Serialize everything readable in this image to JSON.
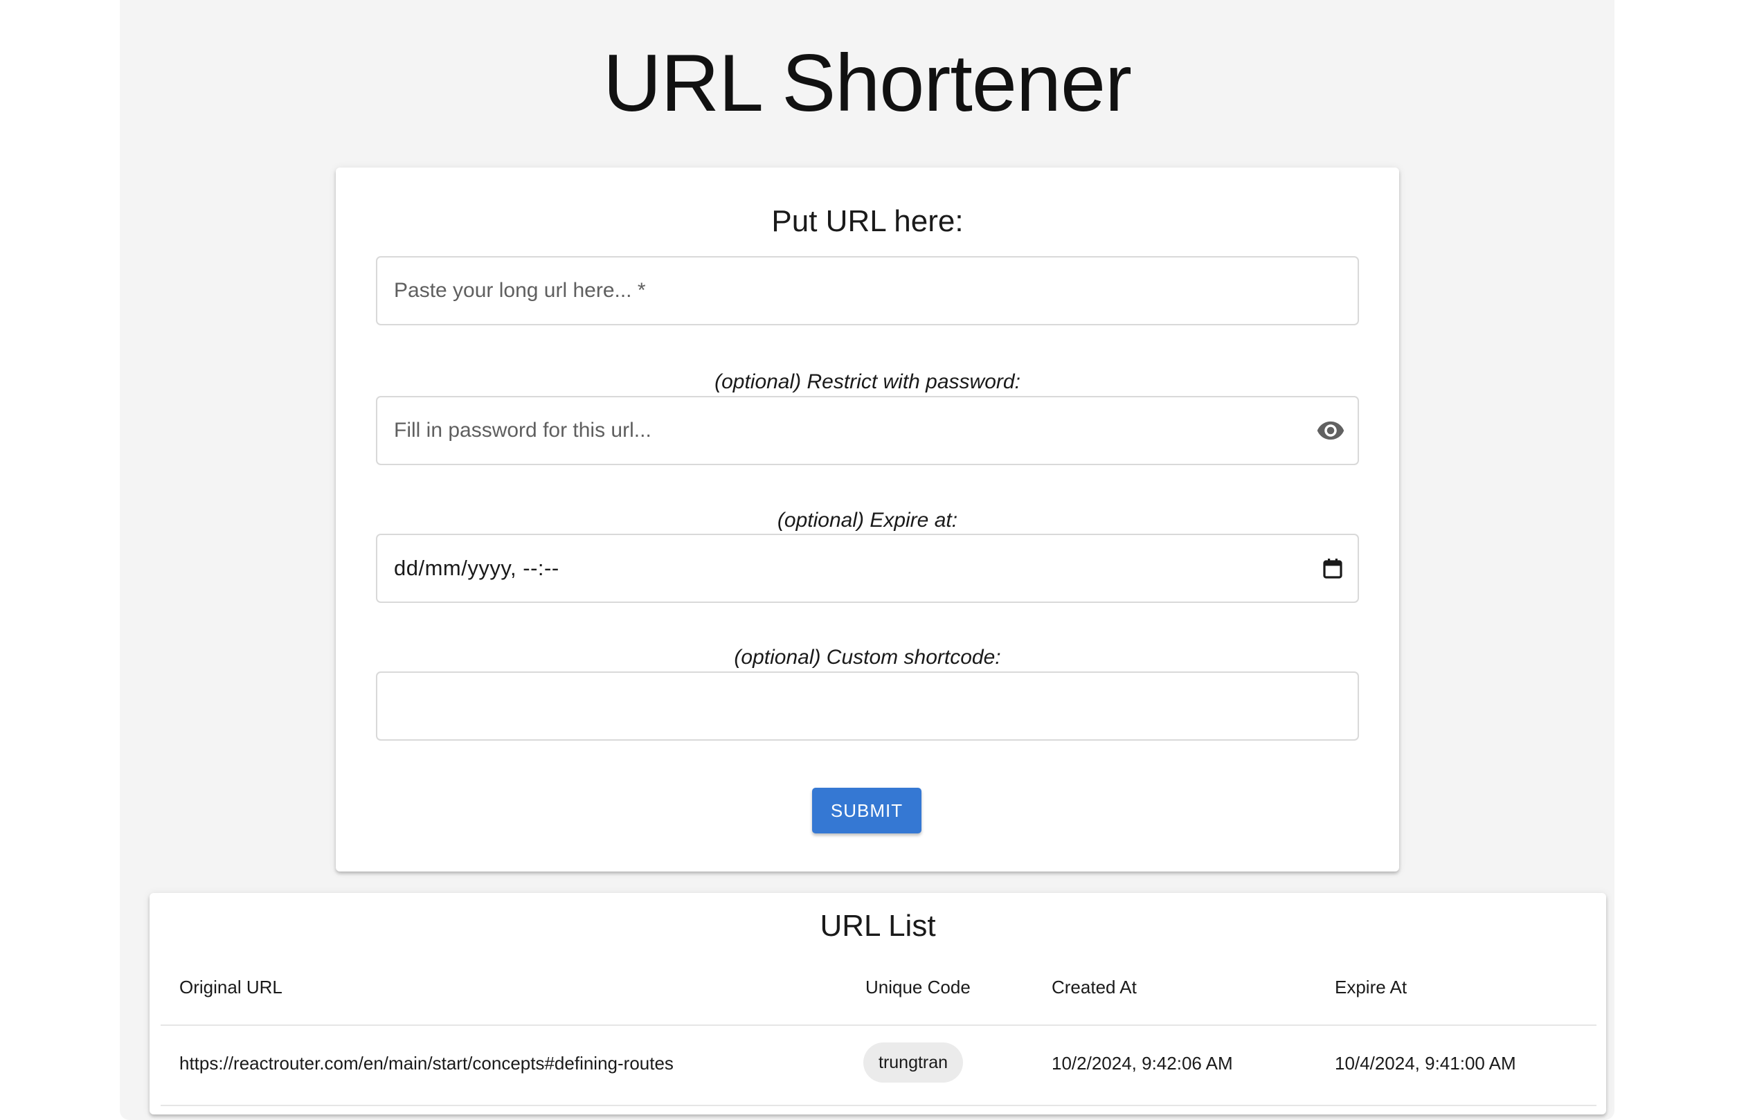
{
  "app": {
    "title": "URL Shortener"
  },
  "form": {
    "heading": "Put URL here:",
    "url_input": {
      "placeholder": "Paste your long url here... *",
      "value": ""
    },
    "password": {
      "label": "(optional) Restrict with password:",
      "placeholder": "Fill in password for this url...",
      "value": "",
      "toggle_icon": "eye-icon"
    },
    "expire": {
      "label": "(optional) Expire at:",
      "placeholder": "dd/mm/yyyy, --:--",
      "value": "",
      "picker_icon": "calendar-icon"
    },
    "shortcode": {
      "label": "(optional) Custom shortcode:",
      "value": ""
    },
    "submit_label": "SUBMIT",
    "accent_color": "#3578d3"
  },
  "url_list": {
    "title": "URL List",
    "columns": [
      "Original URL",
      "Unique Code",
      "Created At",
      "Expire At"
    ],
    "rows": [
      {
        "original_url": "https://reactrouter.com/en/main/start/concepts#defining-routes",
        "unique_code": "trungtran",
        "created_at": "10/2/2024, 9:42:06 AM",
        "expire_at": "10/4/2024, 9:41:00 AM"
      }
    ]
  }
}
